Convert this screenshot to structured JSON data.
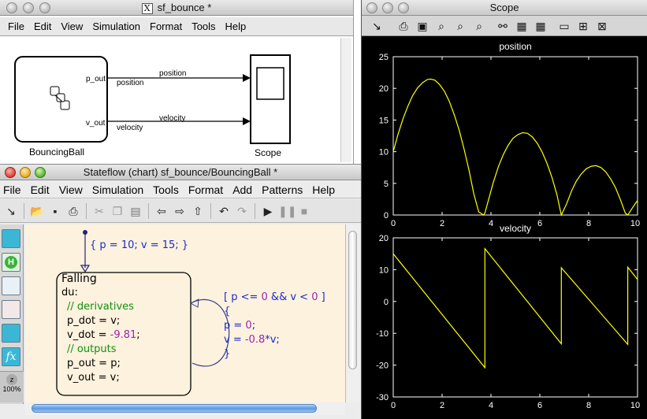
{
  "simulink": {
    "title": "sf_bounce *",
    "window_icon": "X",
    "menu": [
      "File",
      "Edit",
      "View",
      "Simulation",
      "Format",
      "Tools",
      "Help"
    ],
    "block_chart_name": "BouncingBall",
    "block_scope_name": "Scope",
    "ports": {
      "p_out": "p_out",
      "v_out": "v_out"
    },
    "signals": {
      "position_top": "position",
      "position_port": "position",
      "velocity_top": "velocity",
      "velocity_port": "velocity"
    }
  },
  "stateflow": {
    "title": "Stateflow (chart) sf_bounce/BouncingBall *",
    "menu": [
      "File",
      "Edit",
      "View",
      "Simulation",
      "Tools",
      "Format",
      "Add",
      "Patterns",
      "Help"
    ],
    "default_transition": "{ p = 10; v = 15; }",
    "state": {
      "name": "Falling",
      "du": "du:",
      "comment1": "// derivatives",
      "line1_lhs": "p_dot = v;",
      "line2_lhs": "v_dot = ",
      "line2_val": "-9.81",
      "line2_end": ";",
      "comment2": "// outputs",
      "line3": "p_out = p;",
      "line4": "v_out = v;"
    },
    "transition": {
      "cond_open": "[ p <= ",
      "cond_v1": "0",
      "cond_mid": " && v < ",
      "cond_v2": "0",
      "cond_close": " ]",
      "brace_open": "{",
      "act1_lhs": "p = ",
      "act1_val": "0",
      "act1_end": ";",
      "act2_lhs": "v = ",
      "act2_val": "-0.8",
      "act2_end": "*v;",
      "brace_close": "}"
    },
    "zoom_label": "100%"
  },
  "scope": {
    "title": "Scope",
    "colors": {
      "background": "#000000",
      "trace": "#ffff00",
      "axes": "#ffffff"
    }
  },
  "chart_data": [
    {
      "type": "line",
      "title": "position",
      "xlim": [
        0,
        10
      ],
      "ylim": [
        0,
        25
      ],
      "xticks": [
        0,
        2,
        4,
        6,
        8,
        10
      ],
      "yticks": [
        0,
        5,
        10,
        15,
        20,
        25
      ],
      "grid": false,
      "series": [
        {
          "x": [
            0,
            0.2,
            0.4,
            0.6,
            0.8,
            1.0,
            1.2,
            1.4,
            1.53,
            1.7,
            1.9,
            2.1,
            2.3,
            2.5,
            2.7,
            2.9,
            3.1,
            3.3,
            3.5,
            3.7,
            3.75,
            3.9,
            4.1,
            4.3,
            4.5,
            4.7,
            4.9,
            5.1,
            5.3,
            5.5,
            5.7,
            5.9,
            6.1,
            6.3,
            6.5,
            6.7,
            6.88,
            7.1,
            7.3,
            7.5,
            7.7,
            7.9,
            8.1,
            8.3,
            8.5,
            8.7,
            8.9,
            9.1,
            9.3,
            9.5,
            9.6,
            9.8,
            10.0
          ],
          "y": [
            10.0,
            12.8,
            15.2,
            17.2,
            18.9,
            20.1,
            20.9,
            21.4,
            21.47,
            21.3,
            20.6,
            19.5,
            17.9,
            15.8,
            13.4,
            10.4,
            7.1,
            3.3,
            0.5,
            0.0,
            0.3,
            2.4,
            5.2,
            7.6,
            9.5,
            11.0,
            12.1,
            12.7,
            13.0,
            12.9,
            12.3,
            11.3,
            9.9,
            8.1,
            5.9,
            3.2,
            0.0,
            1.8,
            3.8,
            5.4,
            6.5,
            7.3,
            7.7,
            7.8,
            7.5,
            6.8,
            5.7,
            4.3,
            2.4,
            0.3,
            0.0,
            1.2,
            2.3
          ]
        }
      ]
    },
    {
      "type": "line",
      "title": "velocity",
      "xlim": [
        0,
        10
      ],
      "ylim": [
        -30,
        20
      ],
      "xticks": [
        0,
        2,
        4,
        6,
        8,
        10
      ],
      "yticks": [
        -30,
        -20,
        -10,
        0,
        10,
        20
      ],
      "grid": false,
      "series": [
        {
          "x": [
            0,
            3.75,
            3.75,
            6.88,
            6.88,
            9.6,
            9.6,
            10.0
          ],
          "y": [
            15,
            -20.8,
            16.6,
            -13.3,
            10.6,
            -13.5,
            10.8,
            6.9
          ]
        }
      ]
    }
  ]
}
